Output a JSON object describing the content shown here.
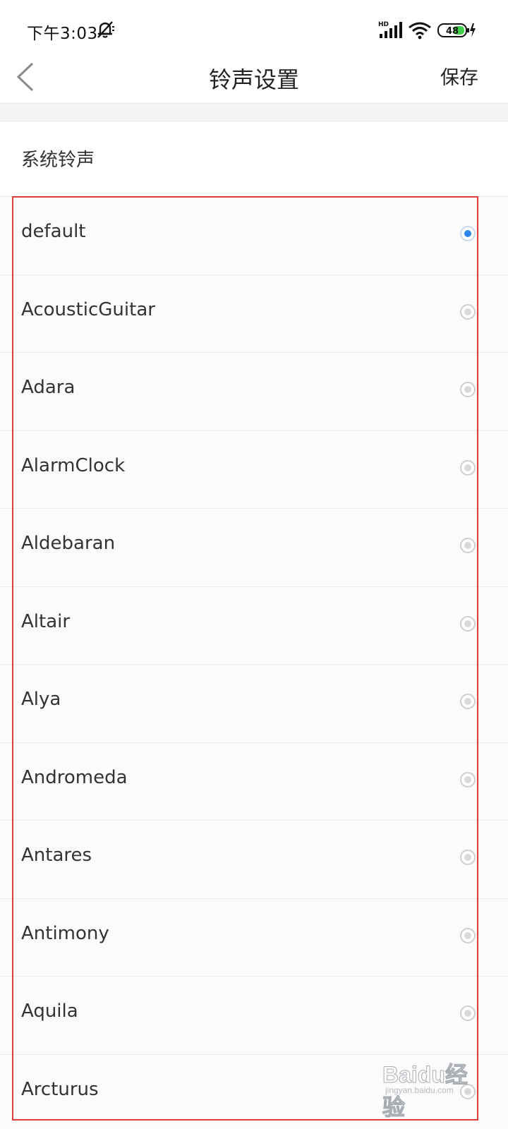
{
  "status_bar": {
    "time": "下午3:03",
    "battery_level": "48",
    "icons": [
      "mute-icon",
      "signal-icon",
      "wifi-icon",
      "battery-icon",
      "charging-icon"
    ]
  },
  "nav": {
    "title": "铃声设置",
    "save_label": "保存",
    "back_icon": "chevron-left-icon"
  },
  "section": {
    "title": "系统铃声"
  },
  "ringtones": [
    {
      "label": "default",
      "selected": true
    },
    {
      "label": "AcousticGuitar",
      "selected": false
    },
    {
      "label": "Adara",
      "selected": false
    },
    {
      "label": "AlarmClock",
      "selected": false
    },
    {
      "label": "Aldebaran",
      "selected": false
    },
    {
      "label": "Altair",
      "selected": false
    },
    {
      "label": "Alya",
      "selected": false
    },
    {
      "label": "Andromeda",
      "selected": false
    },
    {
      "label": "Antares",
      "selected": false
    },
    {
      "label": "Antimony",
      "selected": false
    },
    {
      "label": "Aquila",
      "selected": false
    },
    {
      "label": "Arcturus",
      "selected": false
    }
  ],
  "colors": {
    "selected_radio": "#2f86ea",
    "highlight_frame": "#e23b3b",
    "battery_fill": "#3fcf4a"
  },
  "watermark": {
    "logo": "Baidu经验",
    "sub": "jingyan.baidu.com"
  }
}
